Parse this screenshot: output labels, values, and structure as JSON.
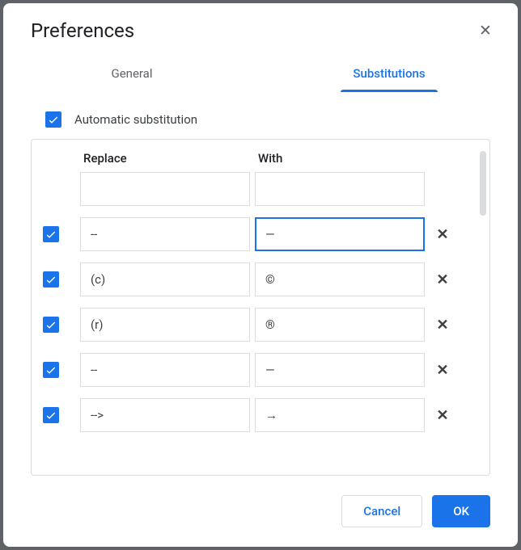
{
  "dialog": {
    "title": "Preferences"
  },
  "tabs": {
    "general": "General",
    "substitutions": "Substitutions"
  },
  "autoSubstitution": {
    "label": "Automatic substitution",
    "checked": true
  },
  "columns": {
    "replace": "Replace",
    "with": "With"
  },
  "rows": [
    {
      "checked": null,
      "replace": "",
      "with": "",
      "deletable": false,
      "focused": false
    },
    {
      "checked": true,
      "replace": "--",
      "with": "—",
      "deletable": true,
      "focused": true
    },
    {
      "checked": true,
      "replace": "(c)",
      "with": "©",
      "deletable": true,
      "focused": false
    },
    {
      "checked": true,
      "replace": "(r)",
      "with": "®",
      "deletable": true,
      "focused": false
    },
    {
      "checked": true,
      "replace": "--",
      "with": "—",
      "deletable": true,
      "focused": false
    },
    {
      "checked": true,
      "replace": "-->",
      "with": "→",
      "deletable": true,
      "focused": false
    }
  ],
  "footer": {
    "cancel": "Cancel",
    "ok": "OK"
  }
}
